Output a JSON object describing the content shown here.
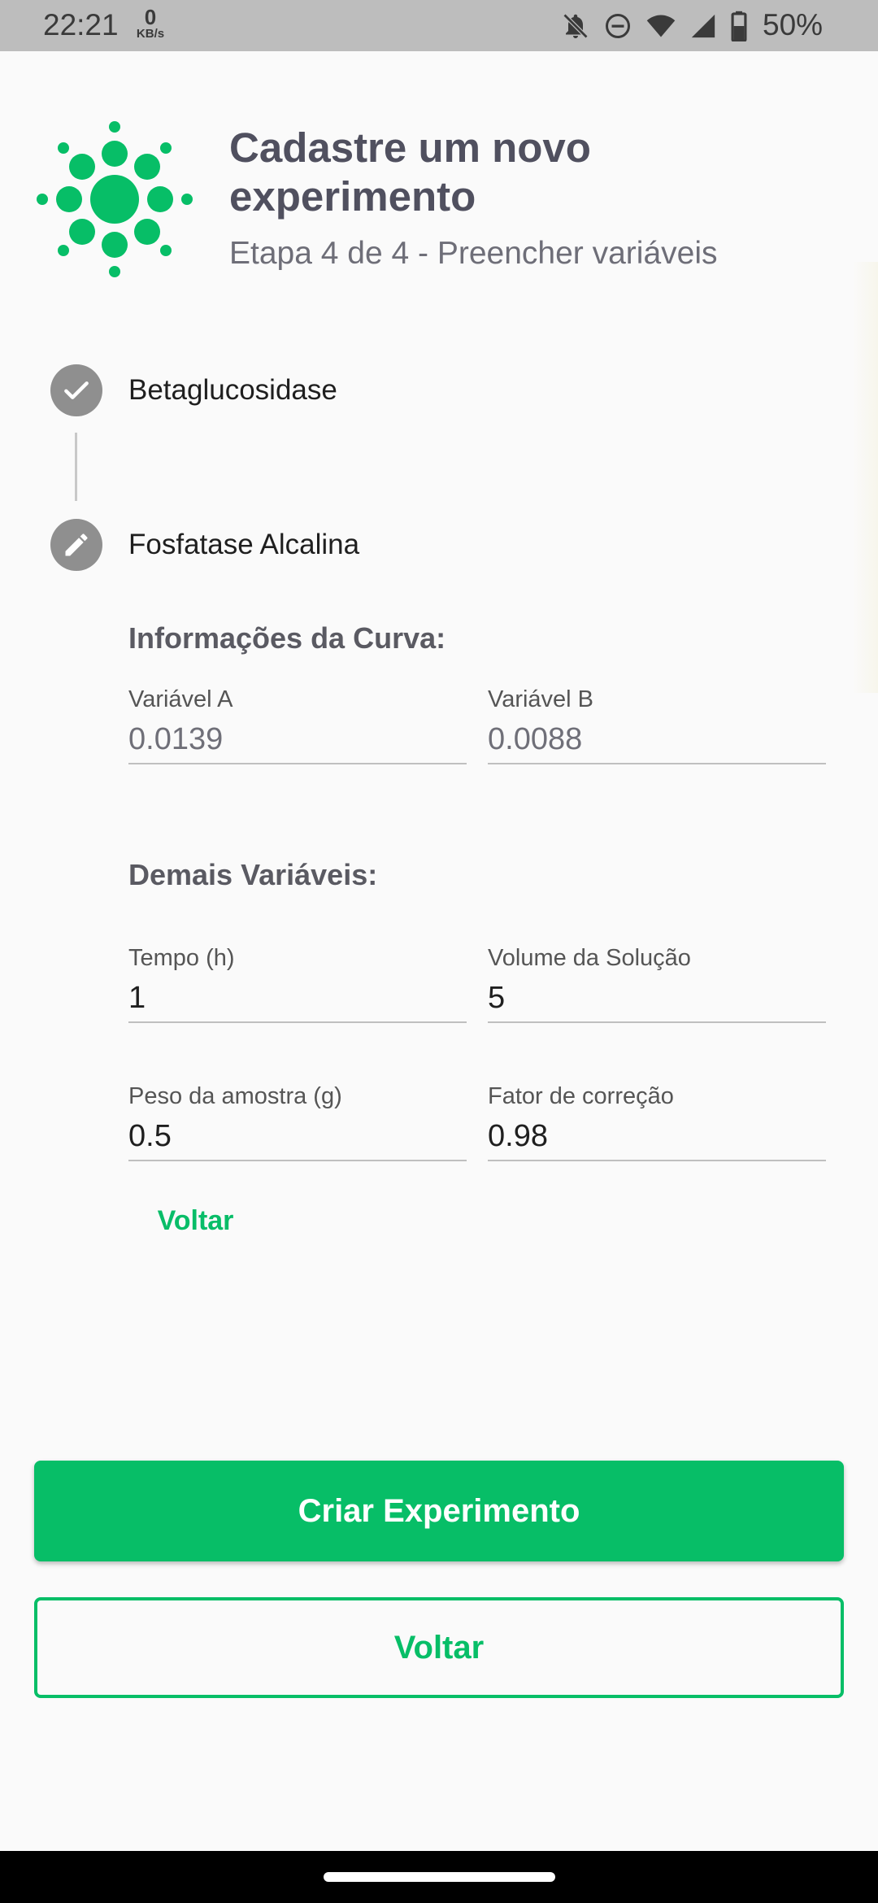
{
  "status_bar": {
    "time": "22:21",
    "net_speed_value": "0",
    "net_speed_unit": "KB/s",
    "battery_percent": "50%",
    "icons": [
      "notifications-off-icon",
      "do-not-disturb-icon",
      "wifi-icon",
      "cellular-signal-icon",
      "battery-icon"
    ]
  },
  "header": {
    "logo": "sun-dots-logo",
    "title": "Cadastre um novo experimento",
    "subtitle": "Etapa 4 de 4 - Preencher variáveis"
  },
  "stepper": {
    "steps": [
      {
        "label": "Betaglucosidase",
        "state": "completed",
        "icon": "check-icon"
      },
      {
        "label": "Fosfatase Alcalina",
        "state": "editing",
        "icon": "pencil-icon"
      }
    ]
  },
  "curve_section": {
    "title": "Informações da Curva:",
    "var_a": {
      "label": "Variável A",
      "value": "0.0139"
    },
    "var_b": {
      "label": "Variável B",
      "value": "0.0088"
    }
  },
  "other_section": {
    "title": "Demais Variáveis:",
    "tempo": {
      "label": "Tempo (h)",
      "value": "1"
    },
    "volume": {
      "label": "Volume da Solução",
      "value": "5"
    },
    "peso": {
      "label": "Peso da amostra (g)",
      "value": "0.5"
    },
    "fator": {
      "label": "Fator de correção",
      "value": "0.98"
    }
  },
  "step_back_label": "Voltar",
  "actions": {
    "create_label": "Criar Experimento",
    "back_label": "Voltar"
  },
  "colors": {
    "accent": "#07be67",
    "title_text": "#50505f",
    "status_bar": "#bdbdbd",
    "step_circle": "#8f8f8f"
  }
}
